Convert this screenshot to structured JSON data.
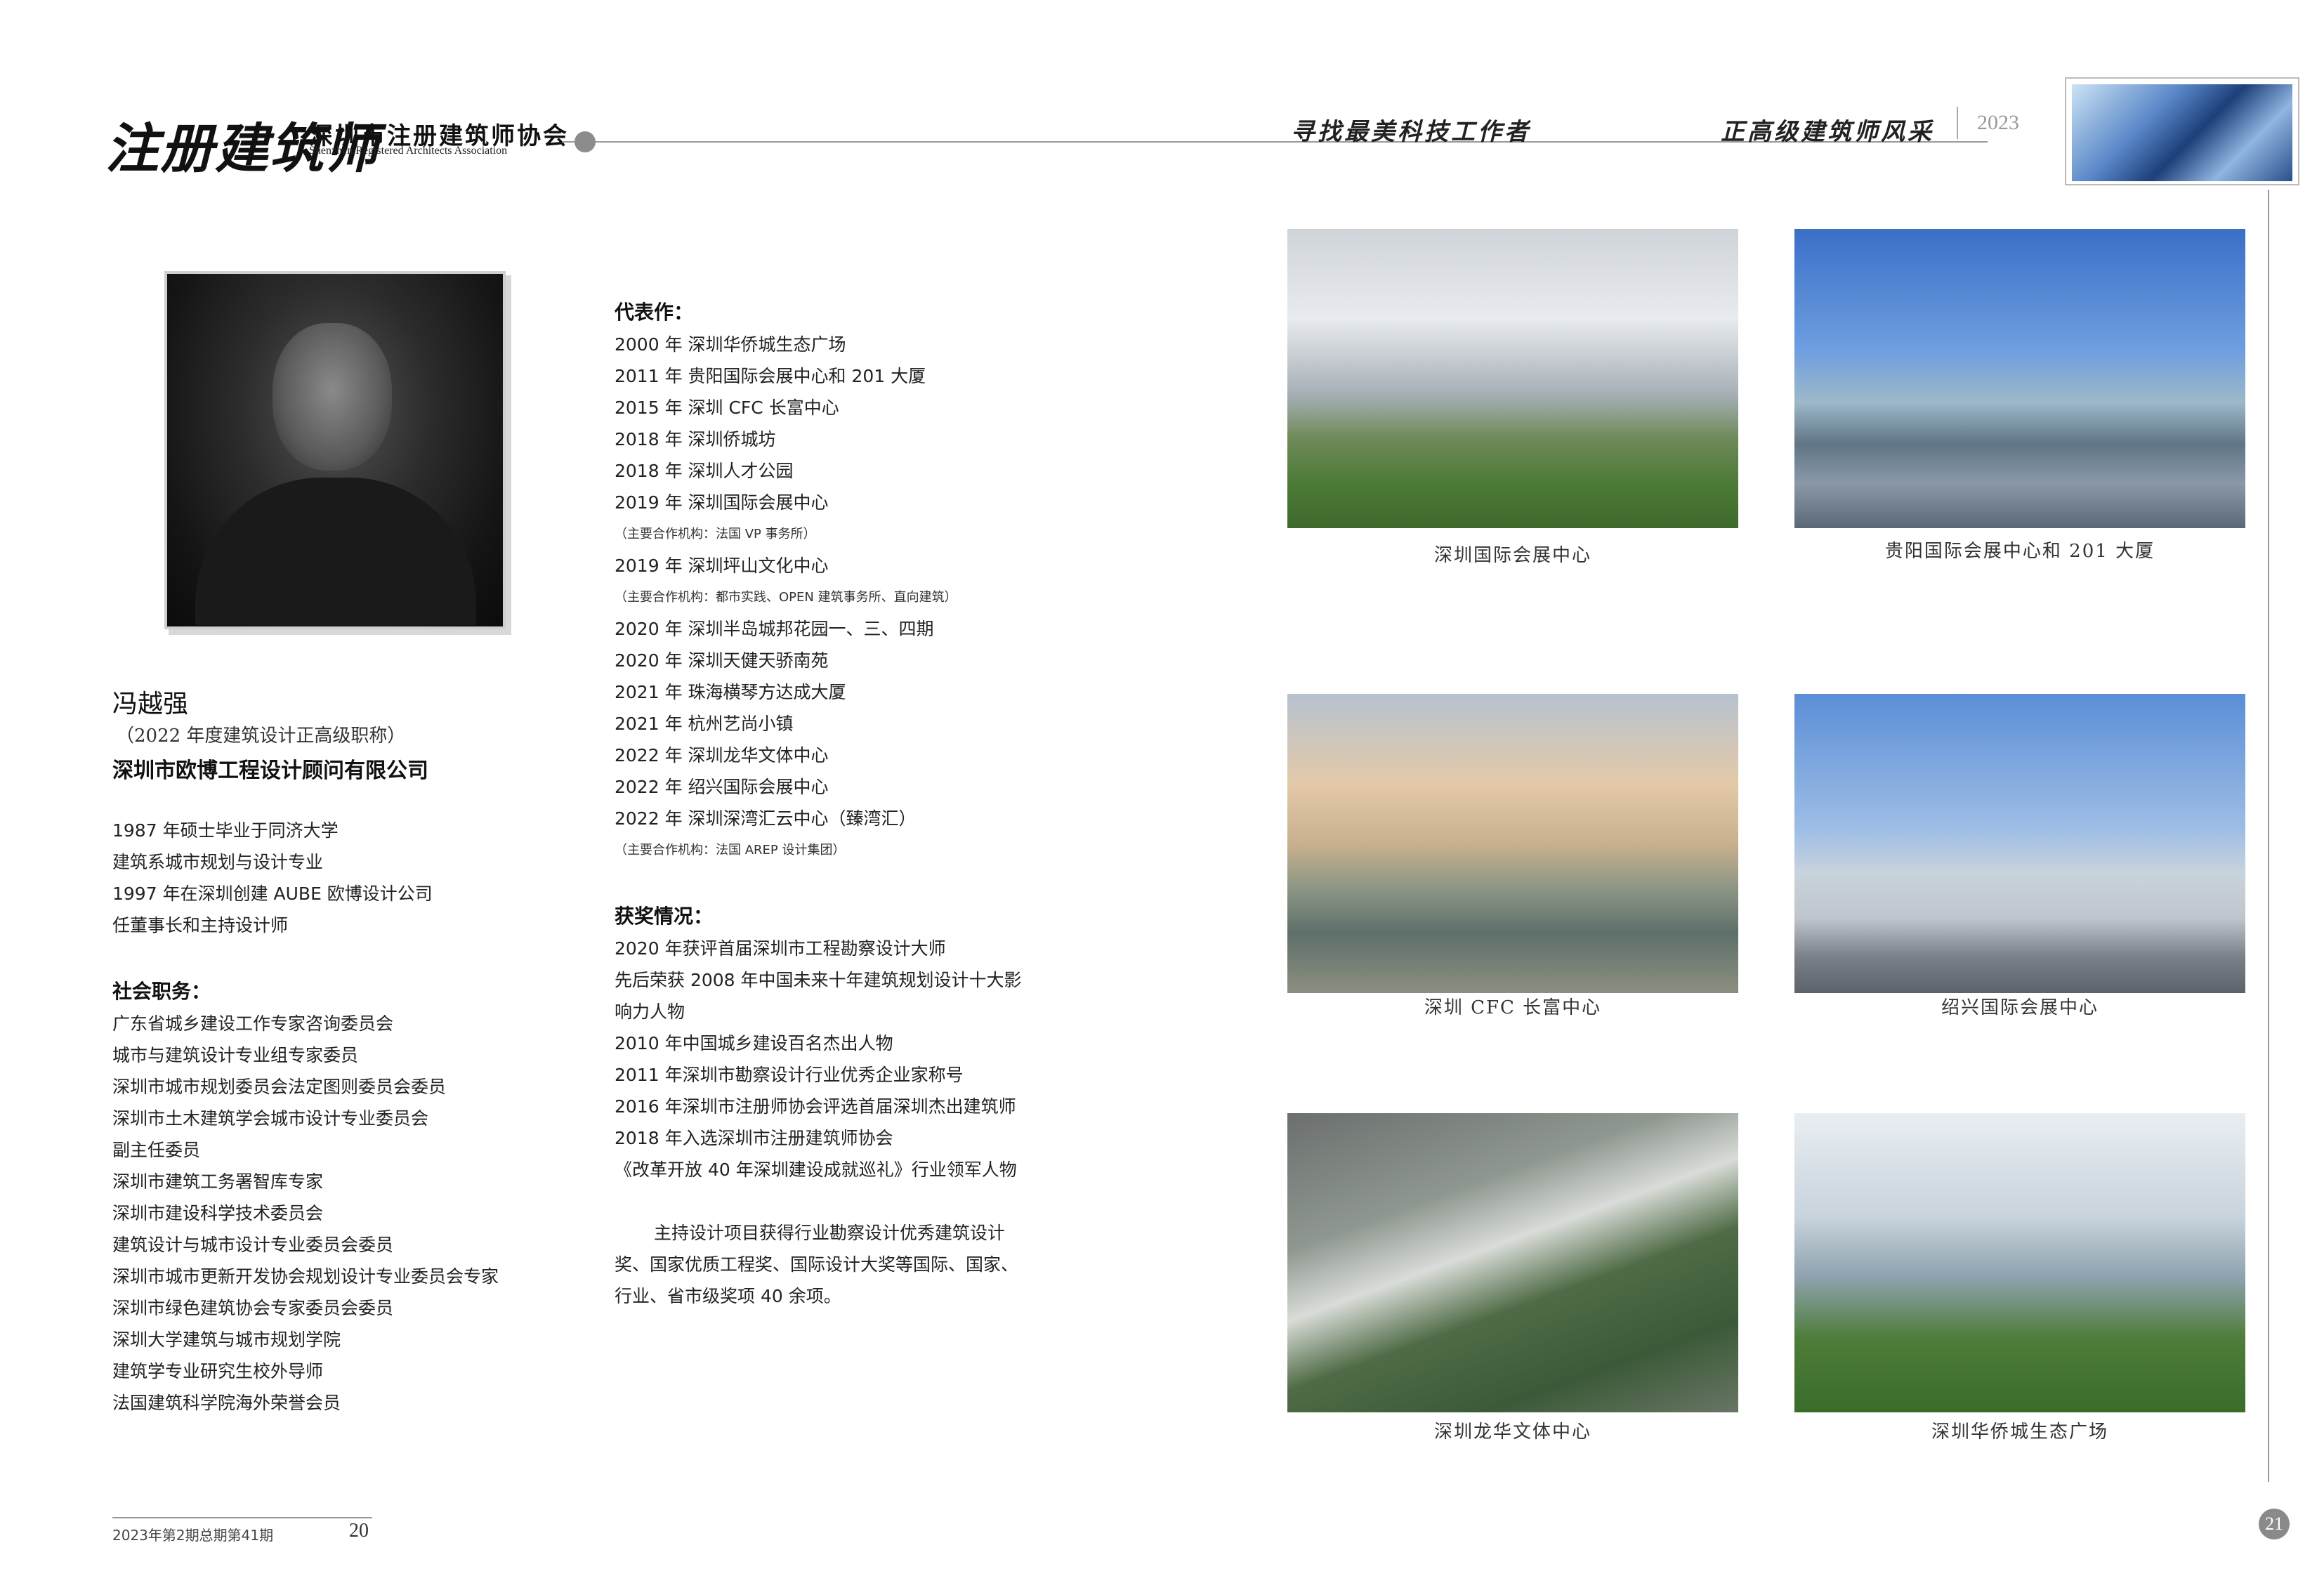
{
  "header": {
    "logo_calligraphy": "注册建筑师",
    "association_cn": "深圳市注册建筑师协会",
    "association_en": "Shenzhen Registered Architects Association",
    "slogan_left": "寻找最美科技工作者",
    "slogan_right": "正高级建筑师风采",
    "year": "2023"
  },
  "person": {
    "name": "冯越强",
    "title_note": "（2022 年度建筑设计正高级职称）",
    "company": "深圳市欧博工程设计顾问有限公司",
    "bio": [
      "1987 年硕士毕业于同济大学",
      "建筑系城市规划与设计专业",
      "1997 年在深圳创建 AUBE 欧博设计公司",
      "任董事长和主持设计师"
    ]
  },
  "social_roles": {
    "title": "社会职务：",
    "items": [
      "广东省城乡建设工作专家咨询委员会",
      "城市与建筑设计专业组专家委员",
      "深圳市城市规划委员会法定图则委员会委员",
      "深圳市土木建筑学会城市设计专业委员会",
      "副主任委员",
      "深圳市建筑工务署智库专家",
      "深圳市建设科学技术委员会",
      "建筑设计与城市设计专业委员会委员",
      "深圳市城市更新开发协会规划设计专业委员会专家",
      "深圳市绿色建筑协会专家委员会委员",
      "深圳大学建筑与城市规划学院",
      "建筑学专业研究生校外导师",
      "法国建筑科学院海外荣誉会员"
    ]
  },
  "works": {
    "title": "代表作：",
    "items": [
      "2000 年 深圳华侨城生态广场",
      "2011 年 贵阳国际会展中心和 201 大厦",
      "2015 年 深圳 CFC 长富中心",
      "2018 年 深圳侨城坊",
      "2018 年 深圳人才公园",
      "2019 年 深圳国际会展中心",
      "（主要合作机构：法国 VP 事务所）",
      "2019 年 深圳坪山文化中心",
      "（主要合作机构：都市实践、OPEN 建筑事务所、直向建筑）",
      "2020 年 深圳半岛城邦花园一、三、四期",
      "2020 年 深圳天健天骄南苑",
      "2021 年 珠海横琴方达成大厦",
      "2021 年 杭州艺尚小镇",
      "2022 年 深圳龙华文体中心",
      "2022 年 绍兴国际会展中心",
      "2022 年 深圳深湾汇云中心（臻湾汇）",
      "（主要合作机构：法国 AREP 设计集团）"
    ]
  },
  "awards": {
    "title": "获奖情况：",
    "items": [
      "2020 年获评首届深圳市工程勘察设计大师",
      "先后荣获 2008 年中国未来十年建筑规划设计十大影",
      "响力人物",
      "2010 年中国城乡建设百名杰出人物",
      "2011 年深圳市勘察设计行业优秀企业家称号",
      "2016 年深圳市注册师协会评选首届深圳杰出建筑师",
      "2018 年入选深圳市注册建筑师协会",
      "《改革开放 40 年深圳建设成就巡礼》行业领军人物"
    ],
    "summary_lines": [
      "主持设计项目获得行业勘察设计优秀建筑设计",
      "奖、国家优质工程奖、国际设计大奖等国际、国家、",
      "行业、省市级奖项 40 余项。"
    ]
  },
  "photos": [
    {
      "caption": "深圳国际会展中心"
    },
    {
      "caption": "贵阳国际会展中心和 201 大厦"
    },
    {
      "caption": "深圳 CFC 长富中心"
    },
    {
      "caption": "绍兴国际会展中心"
    },
    {
      "caption": "深圳龙华文体中心"
    },
    {
      "caption": "深圳华侨城生态广场"
    }
  ],
  "footer": {
    "issue": "2023年第2期总期第41期",
    "page_left": "20",
    "page_right": "21"
  }
}
